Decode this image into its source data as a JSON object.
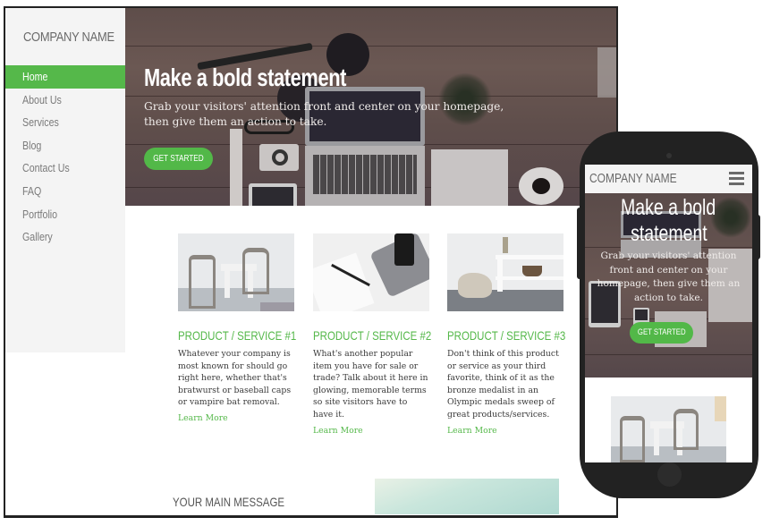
{
  "desktop": {
    "sidebar": {
      "brand": "COMPANY NAME",
      "items": [
        {
          "label": "Home",
          "active": true
        },
        {
          "label": "About Us"
        },
        {
          "label": "Services"
        },
        {
          "label": "Blog"
        },
        {
          "label": "Contact Us"
        },
        {
          "label": "FAQ"
        },
        {
          "label": "Portfolio"
        },
        {
          "label": "Gallery"
        }
      ]
    },
    "hero": {
      "title": "Make a bold statement",
      "subtitle": "Grab your visitors' attention front and center on your homepage, then give them an action to take.",
      "cta": "GET STARTED"
    },
    "products": [
      {
        "title": "PRODUCT / SERVICE #1",
        "text": "Whatever your company is most known for should go right here, whether that's bratwurst or baseball caps or vampire bat removal.",
        "link": "Learn More",
        "image": "chairs-table-photo"
      },
      {
        "title": "PRODUCT / SERVICE #2",
        "text": "What's another popular item you have for sale or trade? Talk about it here in glowing, memorable terms so site visitors have to have it.",
        "link": "Learn More",
        "image": "pen-tablet-phone-photo"
      },
      {
        "title": "PRODUCT / SERVICE #3",
        "text": "Don't think of this product or service as your third favorite, think of it as the bronze medalist in an Olympic medals sweep of great products/services.",
        "link": "Learn More",
        "image": "shelf-room-photo"
      }
    ],
    "main_message": "YOUR MAIN MESSAGE"
  },
  "mobile": {
    "brand": "COMPANY NAME",
    "menu_icon": "hamburger-menu-icon",
    "hero": {
      "title_line1": "Make a bold",
      "title_line2": "statement",
      "subtitle": "Grab your visitors' attention front and center on your homepage, then give them an action to take.",
      "cta": "GET STARTED"
    }
  },
  "colors": {
    "accent": "#55b84a",
    "sidebar_bg": "#f4f4f4",
    "frame": "#222222"
  }
}
